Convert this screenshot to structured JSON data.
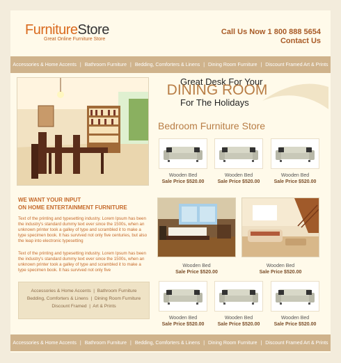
{
  "header": {
    "logo_part1": "Furniture",
    "logo_part2": "Store",
    "tagline": "Great Online Furniture Store",
    "call": "Call Us Now 1 800 888 5654",
    "contact": "Contact Us"
  },
  "nav": {
    "items": [
      "Accessories & Home Accents",
      "Bathroom Furniture",
      "Bedding, Comforters & Linens",
      "Dining Room Furniture",
      "Discount Framed Art & Prints"
    ]
  },
  "promo": {
    "line1": "Great Desk For Your",
    "line2": "DINING ROOM",
    "line3": "For The Holidays"
  },
  "section_title": "Bedroom Furniture Store",
  "products": [
    {
      "name": "Wooden Bed",
      "price": "Sale Price $520.00"
    },
    {
      "name": "Wooden Bed",
      "price": "Sale Price $520.00"
    },
    {
      "name": "Wooden Bed",
      "price": "Sale Price $520.00"
    },
    {
      "name": "Wooden Bed",
      "price": "Sale Price $520.00"
    },
    {
      "name": "Wooden Bed",
      "price": "Sale Price $520.00"
    },
    {
      "name": "Wooden Bed",
      "price": "Sale Price $520.00"
    }
  ],
  "rooms": [
    {
      "name": "Wooden Bed",
      "price": "Sale Price $520.00"
    },
    {
      "name": "Wooden Bed",
      "price": "Sale Price $520.00"
    }
  ],
  "want": {
    "line1": "WE WANT YOUR INPUT",
    "line2": "ON HOME ENTERTAINMENT FURNITURE"
  },
  "paragraph1": "Text of the printing and typesetting industry. Lorem Ipsum has been the industry's standard dummy text ever since the 1500s, when an unknown printer took a galley of type and scrambled it to make a type specimen book. It has survived not only five centuries, but also the leap into electronic typesetting",
  "paragraph2": "Text of the printing and typesetting industry. Lorem Ipsum has been the industry's standard dummy text ever since the 1500s, when an unknown printer took a galley of type and scrambled it to make a type specimen book. It has survived not only five",
  "links": {
    "row1": [
      "Accessories & Home Accents",
      "Bathroom Furniture"
    ],
    "row2": [
      "Bedding, Comforters & Linens",
      "Dining Room Furniture"
    ],
    "row3": [
      "Discount Framed",
      "Art & Prints"
    ]
  },
  "colors": {
    "accent": "#d96a1e",
    "nav": "#cfb38c",
    "background": "#fffaea"
  }
}
